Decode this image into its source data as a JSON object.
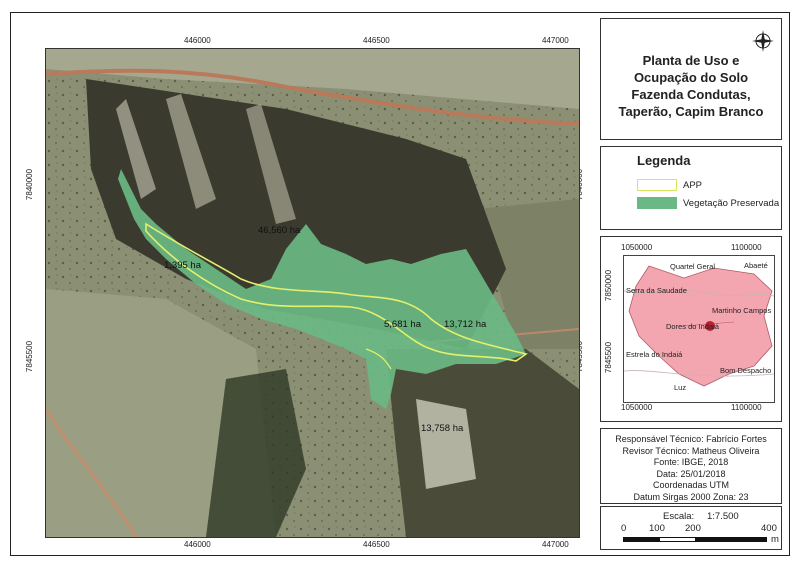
{
  "map": {
    "x_ticks": [
      "446000",
      "446500",
      "447000"
    ],
    "y_ticks": [
      "7840000",
      "7845500"
    ],
    "area_labels": [
      "46,560 ha",
      "1,395 ha",
      "5,681 ha",
      "13,712 ha",
      "13,758 ha"
    ]
  },
  "title": {
    "line1": "Planta de Uso e",
    "line2": "Ocupação do Solo",
    "line3": "Fazenda Condutas,",
    "line4": "Taperão, Capim Branco"
  },
  "legend": {
    "heading": "Legenda",
    "items": [
      {
        "label": "APP",
        "color": "#e3f06b"
      },
      {
        "label": "Vegetação Preservada",
        "color": "#6ab883"
      }
    ]
  },
  "locator": {
    "x_ticks": [
      "1050000",
      "1100000"
    ],
    "y_ticks": [
      "7850000",
      "7845500"
    ],
    "places": [
      "Quartel Geral",
      "Abaeté",
      "Serra da Saudade",
      "Martinho Campos",
      "Dores do Indaiá",
      "Estrela do Indaiá",
      "Bom Despacho",
      "Luz"
    ],
    "region_color": "#f4a6b0"
  },
  "credits": {
    "line1": "Responsável Técnico: Fabrício Fortes",
    "line2": "Revisor Técnico: Matheus Oliveira",
    "line3": "Fonte: IBGE, 2018",
    "line4": "Data: 25/01/2018",
    "line5": "Coordenadas UTM",
    "line6": "Datum Sirgas 2000 Zona: 23"
  },
  "scale": {
    "label": "Escala:",
    "ratio": "1:7.500",
    "ticks": [
      "0",
      "100",
      "200",
      "400"
    ],
    "unit": "m"
  }
}
